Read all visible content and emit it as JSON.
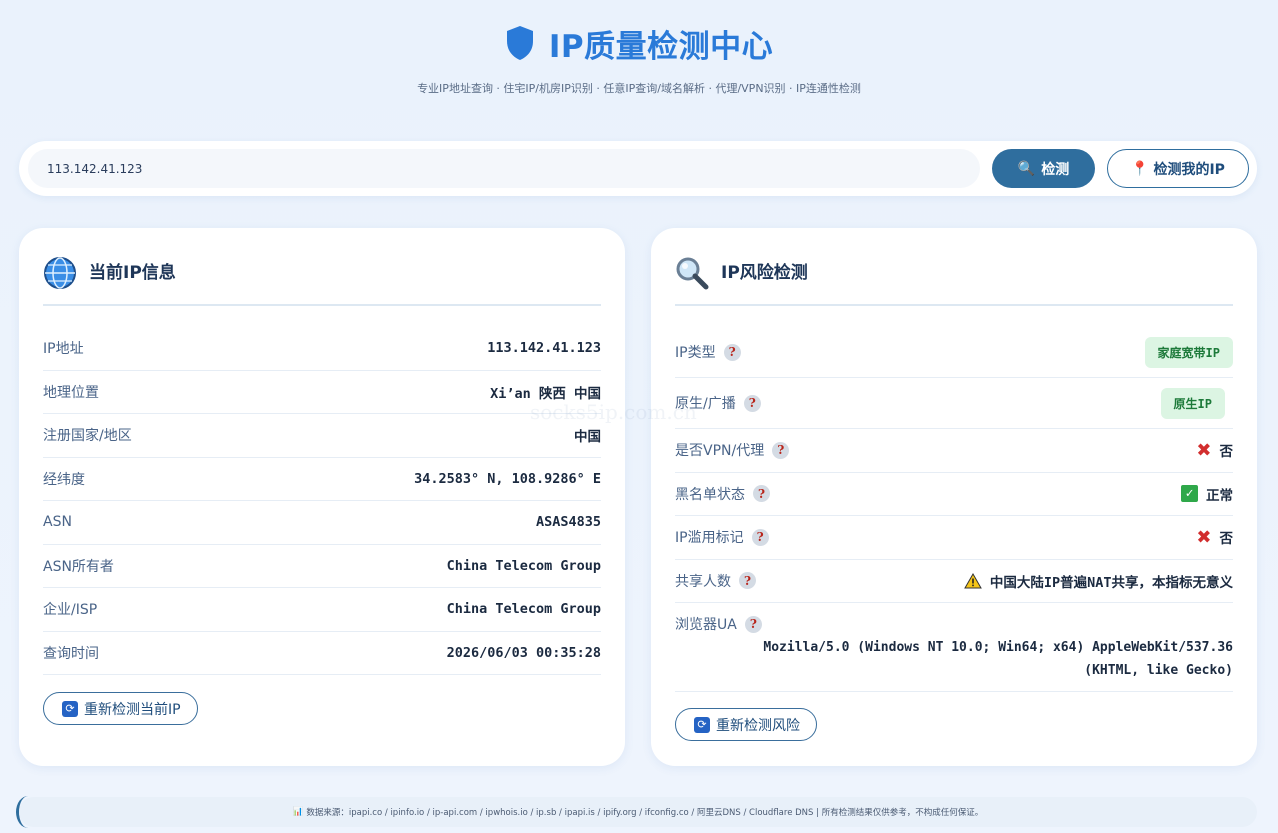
{
  "header": {
    "title": "IP质量检测中心",
    "subtitle": "专业IP地址查询 · 住宅IP/机房IP识别 · 任意IP查询/域名解析 · 代理/VPN识别 · IP连通性检测"
  },
  "search": {
    "value": "113.142.41.123",
    "check_label": "检测",
    "myip_label": "检测我的IP"
  },
  "current_ip": {
    "title": "当前IP信息",
    "rows": [
      {
        "label": "IP地址",
        "value": "113.142.41.123"
      },
      {
        "label": "地理位置",
        "value": "Xi’an 陕西 中国"
      },
      {
        "label": "注册国家/地区",
        "value": "中国"
      },
      {
        "label": "经纬度",
        "value": "34.2583° N, 108.9286° E"
      },
      {
        "label": "ASN",
        "value": "ASAS4835"
      },
      {
        "label": "ASN所有者",
        "value": "China Telecom Group"
      },
      {
        "label": "企业/ISP",
        "value": "China Telecom Group"
      },
      {
        "label": "查询时间",
        "value": "2026/06/03 00:35:28"
      }
    ],
    "recheck_label": "重新检测当前IP"
  },
  "risk": {
    "title": "IP风险检测",
    "ip_type": {
      "label": "IP类型",
      "value": "家庭宽带IP"
    },
    "native": {
      "label": "原生/广播",
      "value": "原生IP"
    },
    "vpn": {
      "label": "是否VPN/代理",
      "value": "否"
    },
    "blacklist": {
      "label": "黑名单状态",
      "value": "正常"
    },
    "abuse": {
      "label": "IP滥用标记",
      "value": "否"
    },
    "shared": {
      "label": "共享人数",
      "value": "中国大陆IP普遍NAT共享，本指标无意义"
    },
    "ua": {
      "label": "浏览器UA",
      "line1": "Mozilla/5.0 (Windows NT 10.0; Win64; x64) AppleWebKit/537.36",
      "line2": "(KHTML, like Gecko)"
    },
    "recheck_label": "重新检测风险"
  },
  "watermark": "socks5ip.com.cn",
  "footer": {
    "text": "数据来源：ipapi.co / ipinfo.io / ip-api.com / ipwhois.io / ip.sb / ipapi.is / ipify.org / ifconfig.co / 阿里云DNS / Cloudflare DNS | 所有检测结果仅供参考，不构成任何保证。"
  },
  "colors": {
    "accent": "#2a7ad8",
    "button": "#2f6e9e",
    "tag_bg": "#dcf5e3",
    "tag_text": "#1d7a3a"
  }
}
